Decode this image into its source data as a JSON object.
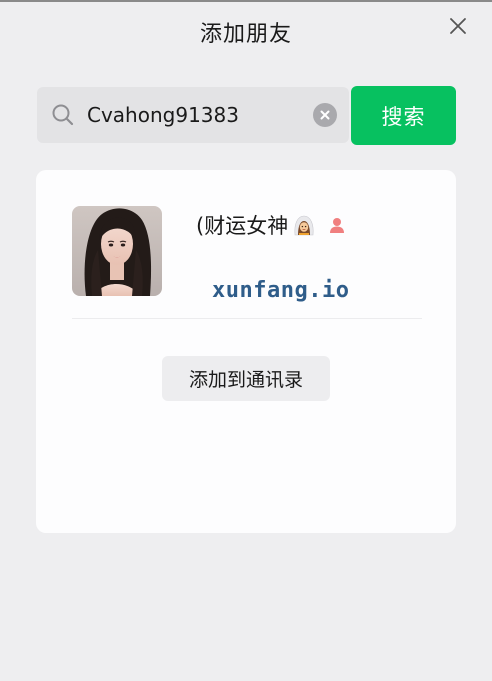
{
  "window": {
    "title": "添加朋友",
    "close_icon": "close-icon"
  },
  "search": {
    "value": "Cvahong91383",
    "search_icon": "search-icon",
    "clear_icon": "clear-icon",
    "button_label": "搜索"
  },
  "result": {
    "avatar_icon": "avatar",
    "nickname": "(财运女神",
    "nickname_emoji": "woman-with-veil-emoji",
    "gender_icon": "female-user-icon",
    "watermark": "xunfang.io",
    "add_button_label": "添加到通讯录"
  },
  "colors": {
    "background": "#eeeef0",
    "accent_green": "#07c160",
    "card": "#fdfdfe",
    "watermark": "#2f5d8a",
    "gender_female": "#f07f7f"
  }
}
